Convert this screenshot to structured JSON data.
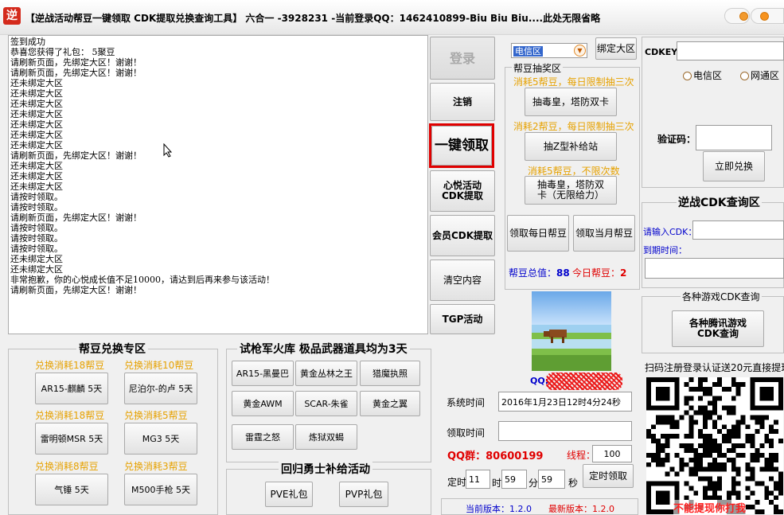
{
  "window": {
    "app_icon_glyph": "逆",
    "title": "【逆战活动帮豆一键领取 CDK提取兑换查询工具】 六合一  -3928231   -当前登录QQ：1462410899-Biu Biu Biu....此处无限省略",
    "accent_color": "#f7931e"
  },
  "log": {
    "lines": [
      "签到成功",
      "恭喜您获得了礼包： 5聚豆",
      "请刷新页面，先绑定大区！谢谢！",
      "请刷新页面，先绑定大区！谢谢！",
      "还未绑定大区",
      "还未绑定大区",
      "还未绑定大区",
      "还未绑定大区",
      "还未绑定大区",
      "还未绑定大区",
      "还未绑定大区",
      "请刷新页面，先绑定大区！谢谢！",
      "还未绑定大区",
      "还未绑定大区",
      "还未绑定大区",
      "请按时领取。",
      "请按时领取。",
      "请刷新页面，先绑定大区！谢谢！",
      "请按时领取。",
      "请按时领取。",
      "请按时领取。",
      "还未绑定大区",
      "还未绑定大区",
      "非常抱歉，你的心悦成长值不足10000，请达到后再来参与该活动！",
      "请刷新页面，先绑定大区！谢谢！"
    ]
  },
  "actions": {
    "login": "登录",
    "logout": "注销",
    "one_click": "一键领取",
    "xinyue_cdk": "心悦活动CDK提取",
    "member_cdk": "会员CDK提取",
    "clear": "清空内容",
    "tgp": "TGP活动"
  },
  "region": {
    "selected": "电信区",
    "bind_button": "绑定大区"
  },
  "lottery": {
    "title": "帮豆抽奖区",
    "cost1": "消耗5帮豆，每日限制抽三次",
    "btn1": "抽毒皇，塔防双卡",
    "cost2": "消耗2帮豆，每日限制抽三次",
    "btn2": "抽Z型补给站",
    "cost3": "消耗5帮豆，不限次数",
    "btn3": "抽毒皇，塔防双卡（无限给力）",
    "daily_btn": "领取每日帮豆",
    "monthly_btn": "领取当月帮豆",
    "total_label": "帮豆总值：",
    "total_value": "88",
    "today_label": "今日帮豆：",
    "today_value": "2"
  },
  "cdkey": {
    "label": "CDKEY：",
    "radio1": "电信区",
    "radio2": "网通区",
    "captcha_label": "验证码：",
    "redeem_button": "立即兑换"
  },
  "query": {
    "title": "逆战CDK查询区",
    "cdk_label": "请输入CDK：",
    "expiry_label": "到期时间："
  },
  "games": {
    "title": "各种游戏CDK查询",
    "button": "各种腾讯游戏CDK查询"
  },
  "qr": {
    "caption": "扫码注册登录认证送20元直接提现",
    "overlay": "不能提现你打我"
  },
  "profile": {
    "qq_label": "QQ:"
  },
  "exchange": {
    "title": "帮豆兑换专区",
    "items": [
      {
        "cost": "兑换消耗18帮豆",
        "button": "AR15-麒麟 5天"
      },
      {
        "cost": "兑换消耗10帮豆",
        "button": "尼泊尔-的卢 5天"
      },
      {
        "cost": "兑换消耗18帮豆",
        "button": "雷明顿MSR 5天"
      },
      {
        "cost": "兑换消耗5帮豆",
        "button": "MG3 5天"
      },
      {
        "cost": "兑换消耗8帮豆",
        "button": "气锤 5天"
      },
      {
        "cost": "兑换消耗3帮豆",
        "button": "M500手枪 5天"
      }
    ]
  },
  "armory": {
    "title": "试枪军火库  极品武器道具均为3天",
    "items": [
      "AR15-黑曼巴",
      "黄金丛林之王",
      "猎魔执照",
      "黄金AWM",
      "SCAR-朱雀",
      "黄金之翼",
      "雷霆之怒",
      "炼狱双蝎"
    ]
  },
  "returner": {
    "title": "回归勇士补给活动",
    "pve": "PVE礼包",
    "pvp": "PVP礼包"
  },
  "timer": {
    "system_time_label": "系统时间",
    "system_time_value": "2016年1月23日12时4分24秒",
    "claim_time_label": "领取时间",
    "claim_time_value": "",
    "qq_group": "QQ群：80600199",
    "threads_label": "线程：",
    "threads_value": "100",
    "schedule_label": "定时",
    "hour": "11",
    "hour_unit": "时",
    "minute": "59",
    "minute_unit": "分",
    "second": "59",
    "second_unit": "秒",
    "schedule_button": "定时领取"
  },
  "version": {
    "current": "当前版本：1.2.0",
    "latest": "最新版本：1.2.0"
  }
}
